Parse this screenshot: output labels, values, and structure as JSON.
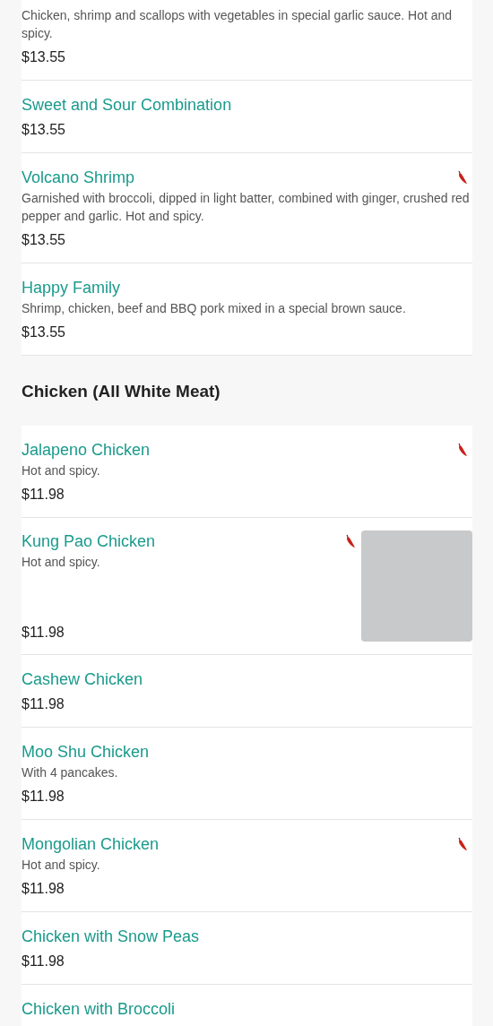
{
  "sections": [
    {
      "items": [
        {
          "description": "Chicken, shrimp and scallops with vegetables in special garlic sauce. Hot and spicy.",
          "price": "$13.55",
          "spicy": false
        },
        {
          "name": "Sweet and Sour Combination",
          "price": "$13.55",
          "spicy": false
        },
        {
          "name": "Volcano Shrimp",
          "description": "Garnished with broccoli, dipped in light batter, combined with ginger, crushed red pepper and garlic. Hot and spicy.",
          "price": "$13.55",
          "spicy": true
        },
        {
          "name": "Happy Family",
          "description": "Shrimp, chicken, beef and BBQ pork mixed in a special brown sauce.",
          "price": "$13.55",
          "spicy": false
        }
      ]
    },
    {
      "heading": "Chicken (All White Meat)",
      "items": [
        {
          "name": "Jalapeno Chicken",
          "description": "Hot and spicy.",
          "price": "$11.98",
          "spicy": true
        },
        {
          "name": "Kung Pao Chicken",
          "description": "Hot and spicy.",
          "price": "$11.98",
          "spicy": true,
          "image": {
            "kind": "placeholder"
          }
        },
        {
          "name": "Cashew Chicken",
          "price": "$11.98",
          "spicy": false
        },
        {
          "name": "Moo Shu Chicken",
          "description": "With 4 pancakes.",
          "price": "$11.98",
          "spicy": false
        },
        {
          "name": "Mongolian Chicken",
          "description": "Hot and spicy.",
          "price": "$11.98",
          "spicy": true
        },
        {
          "name": "Chicken with Snow Peas",
          "price": "$11.98",
          "spicy": false
        },
        {
          "name": "Chicken with Broccoli",
          "spicy": false
        }
      ]
    }
  ]
}
